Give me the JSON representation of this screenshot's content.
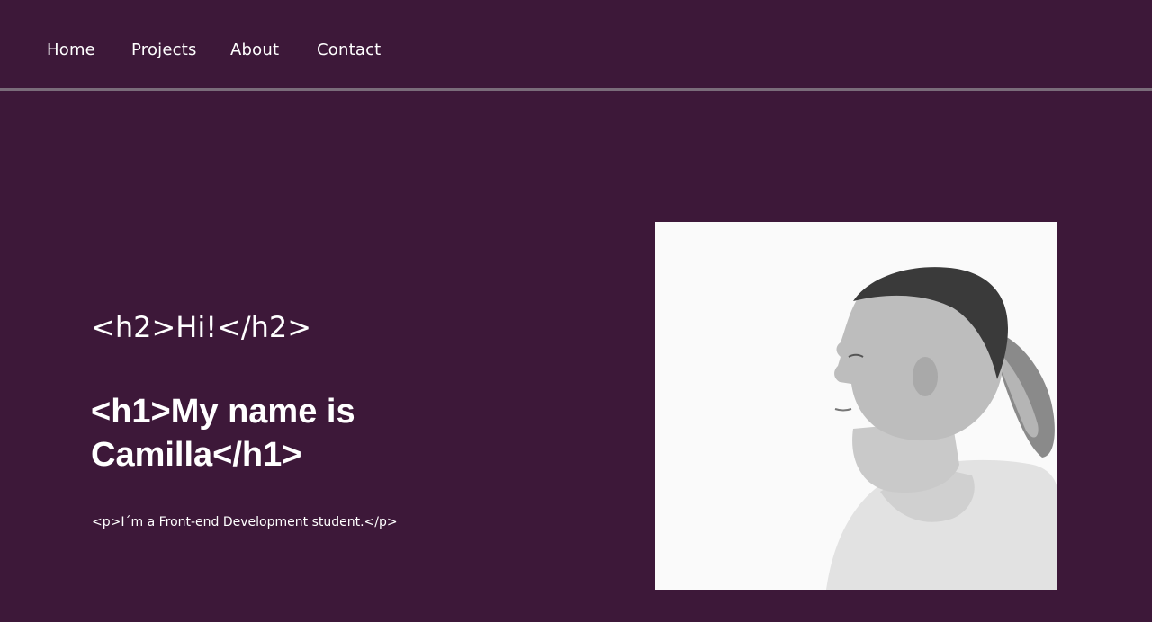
{
  "nav": {
    "items": [
      {
        "label": "Home"
      },
      {
        "label": "Projects"
      },
      {
        "label": "About"
      },
      {
        "label": "Contact"
      }
    ]
  },
  "hero": {
    "greeting": "<h2>Hi!</h2>",
    "title": "<h1>My name is Camilla</h1>",
    "text": "<p>I´m a Front-end Development student.</p>"
  },
  "colors": {
    "background": "#3d1839",
    "divider": "#7a6c7a",
    "text": "#ffffff"
  },
  "portrait": {
    "icon": "profile-photo"
  }
}
